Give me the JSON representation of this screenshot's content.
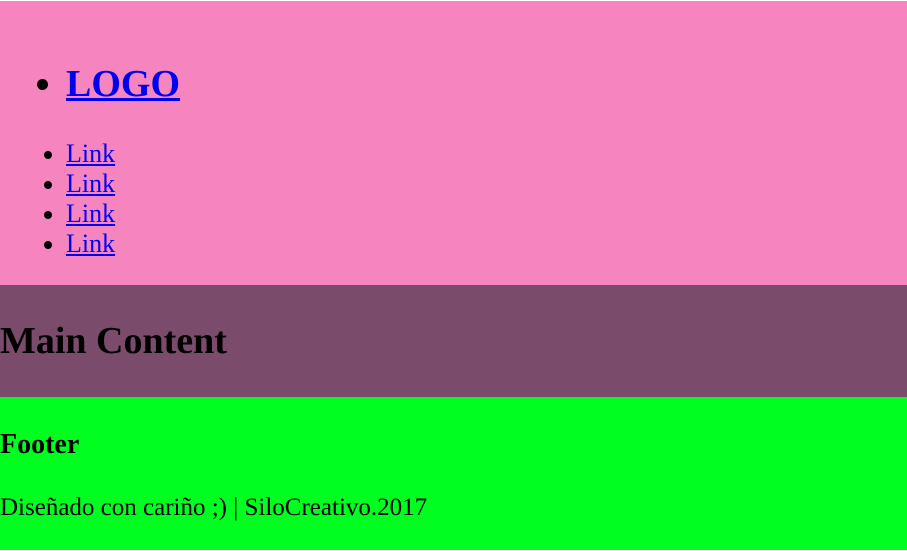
{
  "header": {
    "logo": "LOGO",
    "nav_links": [
      "Link",
      "Link",
      "Link",
      "Link"
    ]
  },
  "main": {
    "heading": "Main Content"
  },
  "footer": {
    "heading": "Footer",
    "credit": "Diseñado con cariño ;) | SiloCreativo.2017"
  },
  "colors": {
    "header_bg": "#f684bf",
    "main_bg": "#7a4b6b",
    "footer_bg": "#00ff21",
    "link": "#0000ee"
  }
}
